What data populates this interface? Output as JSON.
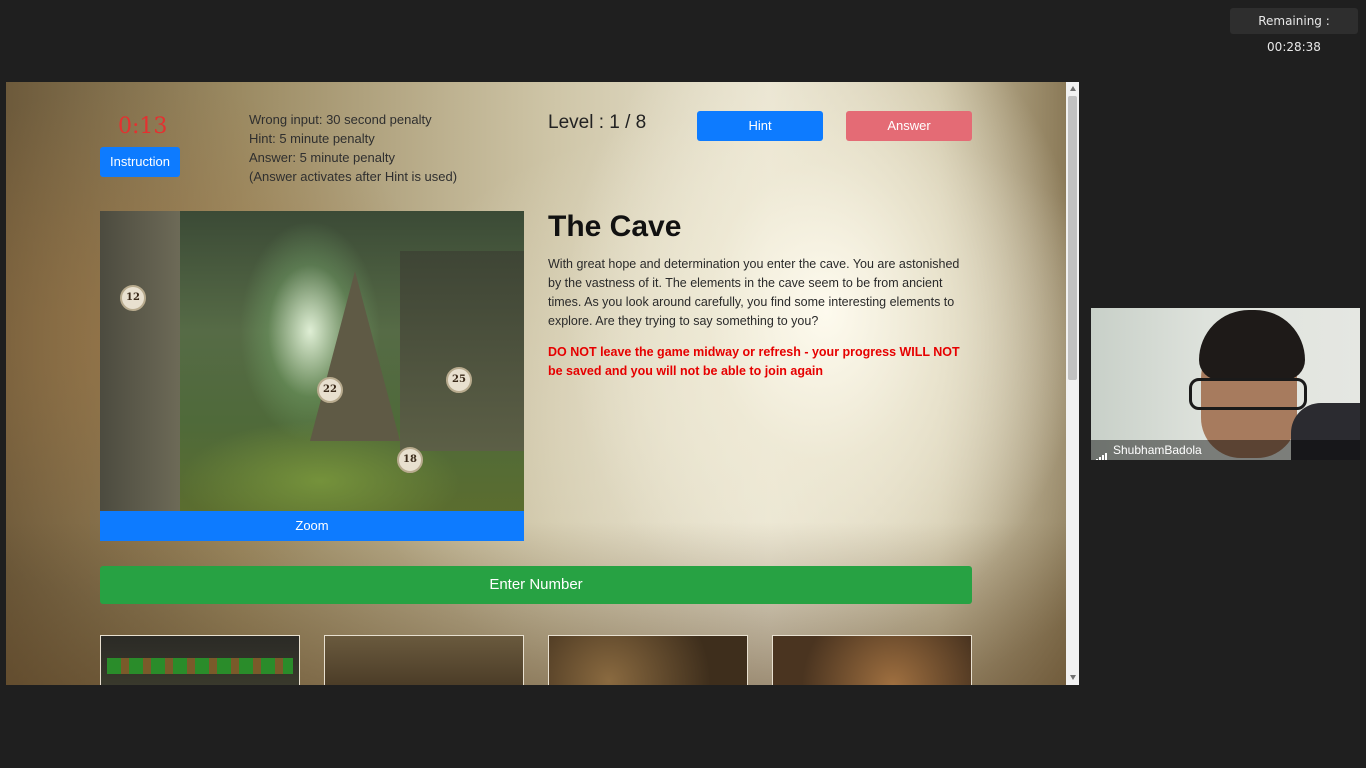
{
  "meeting": {
    "remaining": "Remaining : 00:28:38",
    "participant_name": "ShubhamBadola"
  },
  "game": {
    "timer": "0:13",
    "instruction_label": "Instruction",
    "penalties": [
      "Wrong input: 30 second penalty",
      "Hint: 5 minute penalty",
      "Answer: 5 minute penalty",
      "(Answer activates after Hint is used)"
    ],
    "level": "Level : 1 / 8",
    "hint_label": "Hint",
    "answer_label": "Answer",
    "image_markers": [
      "12",
      "22",
      "25",
      "18"
    ],
    "zoom_label": "Zoom",
    "title": "The Cave",
    "story": "With great hope and determination you enter the cave. You are astonished by the vastness of it. The elements in the cave seem to be from ancient times. As you look around carefully, you find some interesting elements to explore. Are they trying to say something to you?",
    "warning": "DO NOT leave the game midway or refresh - your progress WILL NOT be saved and you will not be able to join again",
    "enter_label": "Enter Number"
  },
  "colors": {
    "primary_button": "#0d7bff",
    "answer_button_disabled": "#e46b75",
    "enter_button": "#27a243",
    "timer": "#e53030",
    "warning": "#e60000"
  }
}
